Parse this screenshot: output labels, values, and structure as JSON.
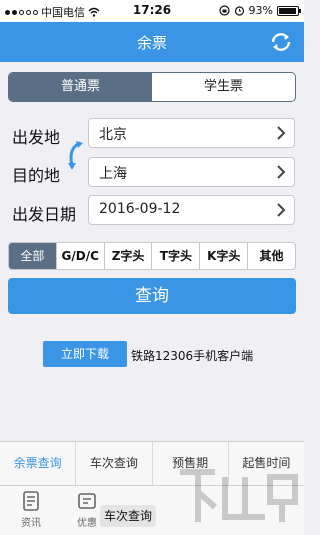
{
  "status": {
    "carrier": "中国电信",
    "time": "17:26",
    "battery": "93%",
    "battery_level": 0.93
  },
  "nav": {
    "title": "余票"
  },
  "ticket_type": {
    "options": [
      "普通票",
      "学生票"
    ],
    "selected": "普通票"
  },
  "form": {
    "from_label": "出发地",
    "from_value": "北京",
    "to_label": "目的地",
    "to_value": "上海",
    "date_label": "出发日期",
    "date_value": "2016-09-12"
  },
  "filters": {
    "items": [
      "全部",
      "G/D/C",
      "Z字头",
      "T字头",
      "K字头",
      "其他"
    ],
    "selected": "全部"
  },
  "query_button": "查询",
  "download": {
    "button": "立即下载",
    "text": "铁路12306手机客户端"
  },
  "sub_tabs": {
    "items": [
      "余票查询",
      "车次查询",
      "预售期",
      "起售时间"
    ],
    "selected": "余票查询"
  },
  "bottom_tabs": {
    "items": [
      "资讯",
      "优惠"
    ]
  },
  "popup_label": "车次查询",
  "accent_color": "#3b95e6"
}
